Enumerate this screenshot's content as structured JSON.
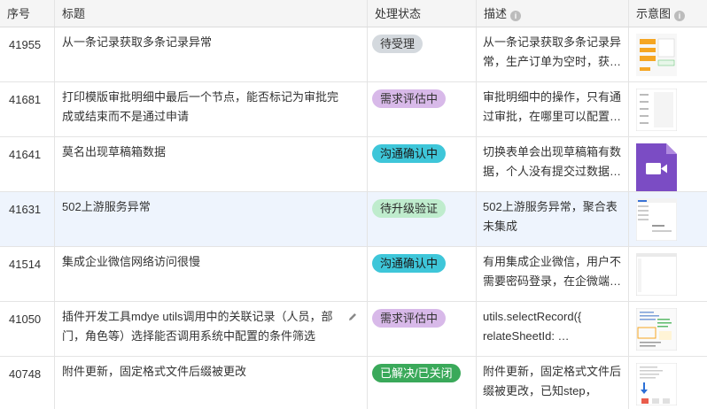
{
  "columns": {
    "id": "序号",
    "title": "标题",
    "status": "处理状态",
    "desc": "描述",
    "thumb": "示意图"
  },
  "colors": {
    "待受理": {
      "bg": "#d4d9de",
      "fg": "#333333"
    },
    "需求评估中": {
      "bg": "#d8b9e9",
      "fg": "#333333"
    },
    "沟通确认中": {
      "bg": "#3ec6d9",
      "fg": "#1a1a1a"
    },
    "待升级验证": {
      "bg": "#bfeccd",
      "fg": "#2a2a2a"
    },
    "已解决/已关闭": {
      "bg": "#3aa95a",
      "fg": "#ffffff"
    }
  },
  "rows": [
    {
      "id": "41955",
      "title": "从一条记录获取多条记录异常",
      "status": "待受理",
      "desc": "从一条记录获取多条记录异常，生产订单为空时，获…",
      "thumb": "orange-form-icon"
    },
    {
      "id": "41681",
      "title": "打印模版审批明细中最后一个节点，能否标记为审批完成或结束而不是通过申请",
      "status": "需求评估中",
      "desc": "审批明细中的操作，只有通过审批，在哪里可以配置…",
      "thumb": "table-list-icon"
    },
    {
      "id": "41641",
      "title": "莫名出现草稿箱数据",
      "status": "沟通确认中",
      "desc": "切换表单会出现草稿箱有数据，个人没有提交过数据…",
      "thumb": "video-file-icon"
    },
    {
      "id": "41631",
      "title": "502上游服务异常",
      "status": "待升级验证",
      "desc": "502上游服务异常，聚合表未集成",
      "thumb": "sidebar-app-icon"
    },
    {
      "id": "41514",
      "title": "集成企业微信网络访问很慢",
      "status": "沟通确认中",
      "desc": "有用集成企业微信，用户不需要密码登录，在企微端…",
      "thumb": "blank-window-icon"
    },
    {
      "id": "41050",
      "title": "插件开发工具mdye utils调用中的关联记录（人员，部门，角色等）选择能否调用系统中配置的条件筛选",
      "status": "需求评估中",
      "desc": "utils.selectRecord({ relateSheetId: …",
      "thumb": "code-editor-icon"
    },
    {
      "id": "40748",
      "title": "附件更新，固定格式文件后缀被更改",
      "status": "已解决/已关闭",
      "desc": "附件更新，固定格式文件后缀被更改，已知step，stp…",
      "thumb": "mobile-screen-icon"
    }
  ]
}
